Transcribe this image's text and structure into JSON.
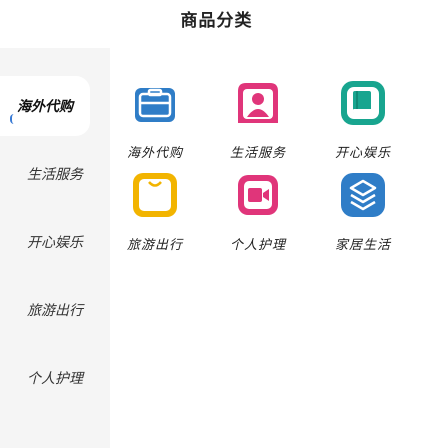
{
  "page": {
    "title": "商品分类"
  },
  "sidebar": {
    "items": [
      {
        "label": "海外代购",
        "active": true
      },
      {
        "label": "生活服务",
        "active": false
      },
      {
        "label": "开心娱乐",
        "active": false
      },
      {
        "label": "旅游出行",
        "active": false
      },
      {
        "label": "个人护理",
        "active": false
      }
    ]
  },
  "grid": {
    "items": [
      {
        "label": "海外代购",
        "icon": "briefcase-icon",
        "color": "#2f7dc7"
      },
      {
        "label": "生活服务",
        "icon": "person-icon",
        "color": "#e0357a"
      },
      {
        "label": "开心娱乐",
        "icon": "book-icon",
        "color": "#18a58f"
      },
      {
        "label": "旅游出行",
        "icon": "bag-icon",
        "color": "#f2b400"
      },
      {
        "label": "个人护理",
        "icon": "video-icon",
        "color": "#e0357a"
      },
      {
        "label": "家居生活",
        "icon": "layers-icon",
        "color": "#2f7dc7"
      }
    ]
  },
  "colors": {
    "active_indicator": "#3a7bd5",
    "sidebar_bg": "#f5f5f5"
  }
}
